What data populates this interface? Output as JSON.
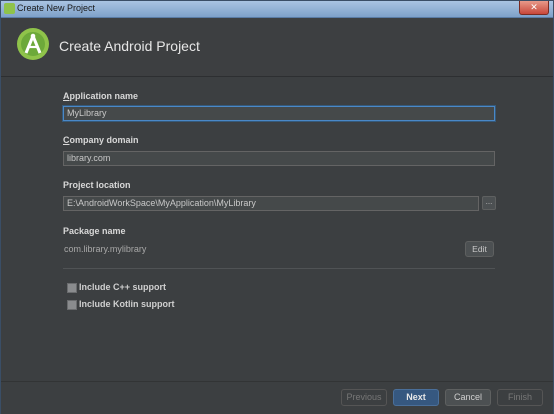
{
  "window": {
    "title": "Create New Project",
    "close_glyph": "✕"
  },
  "header": {
    "title": "Create Android Project",
    "logo_icon": "android-studio-icon"
  },
  "form": {
    "app_name": {
      "label_accel": "A",
      "label_rest": "pplication name",
      "value": "MyLibrary"
    },
    "company_domain": {
      "label_accel": "C",
      "label_rest": "ompany domain",
      "value": "library.com"
    },
    "project_location": {
      "label": "Project location",
      "value": "E:\\AndroidWorkSpace\\MyApplication\\MyLibrary",
      "browse_label": "..."
    },
    "package_name": {
      "label": "Package name",
      "value": "com.library.mylibrary",
      "edit_label": "Edit"
    }
  },
  "options": [
    {
      "label": "Include C++ support",
      "checked": false
    },
    {
      "label": "Include Kotlin support",
      "checked": false
    }
  ],
  "footer": {
    "previous": "Previous",
    "next": "Next",
    "cancel": "Cancel",
    "finish": "Finish"
  },
  "colors": {
    "accent": "#4a88c7",
    "primary_button": "#365880",
    "android_green": "#8fc34a"
  }
}
